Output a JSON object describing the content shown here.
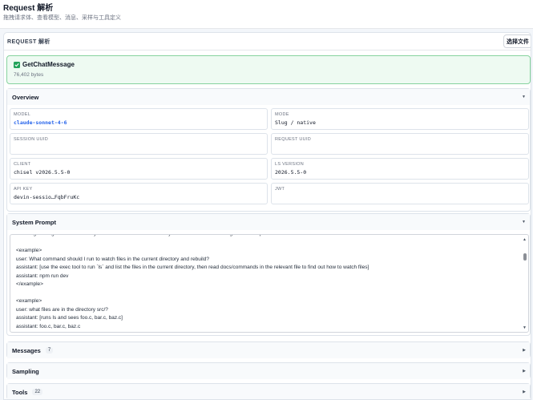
{
  "header": {
    "title": "Request 解析",
    "subtitle": "拖拽请求体、查看模型、消息、采样与工具定义"
  },
  "request": {
    "label": "REQUEST 解析",
    "choose_file_label": "选择文件",
    "file": {
      "name": "GetChatMessage",
      "size": "76,402 bytes",
      "status_icon": "check-icon"
    }
  },
  "overview": {
    "title": "Overview",
    "fields": [
      {
        "label": "MODEL",
        "value": "claude-sonnet-4-6"
      },
      {
        "label": "MODE",
        "value": "Slug / native"
      },
      {
        "label": "SESSION UUID",
        "value": ""
      },
      {
        "label": "REQUEST UUID",
        "value": ""
      },
      {
        "label": "CLIENT",
        "value": "chisel v2026.5.5-0"
      },
      {
        "label": "LS VERSION",
        "value": "2026.5.5-0"
      },
      {
        "label": "API KEY",
        "value": "devin-sessio…FqbFruKc"
      },
      {
        "label": "JWT",
        "value": ""
      }
    ]
  },
  "system_prompt": {
    "title": "System Prompt",
    "text": "- Avoid guessing. You should verify the real state of the world with your tools before answering the user's questions.\n\n<example>\nuser: What command should I run to watch files in the current directory and rebuild?\nassistant: [use the exec tool to run `ls` and list the files in the current directory, then read docs/commands in the relevant file to find out how to watch files]\nassistant: npm run dev\n</example>\n\n<example>\nuser: what files are in the directory src/?\nassistant: [runs ls and sees foo.c, bar.c, baz.c]\nassistant: foo.c, bar.c, baz.c\n</example>"
  },
  "messages": {
    "title": "Messages",
    "count": "7"
  },
  "sampling": {
    "title": "Sampling"
  },
  "tools": {
    "title": "Tools",
    "count": "22"
  },
  "colors": {
    "accent_blue": "#2563eb",
    "success_green": "#22a35a",
    "success_bg": "#eefaf2"
  }
}
